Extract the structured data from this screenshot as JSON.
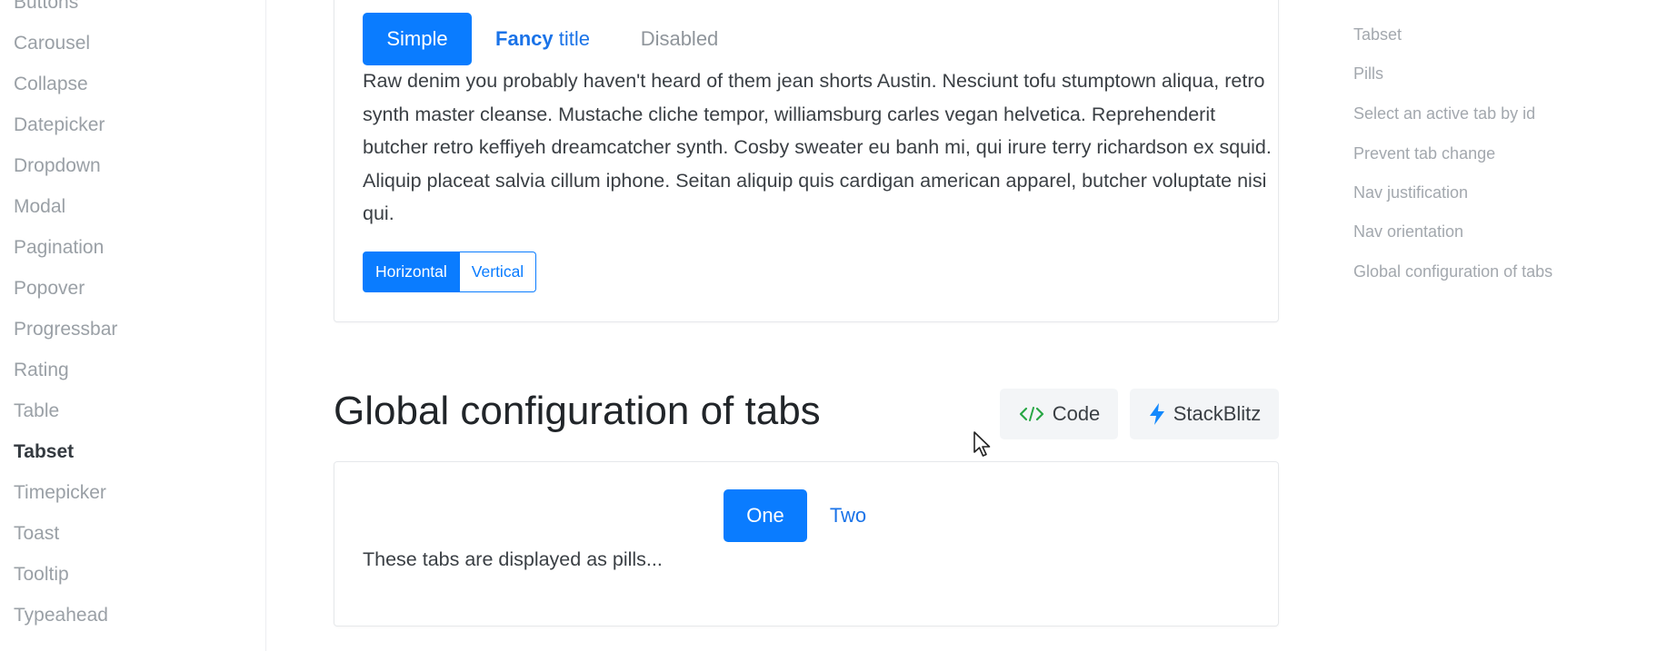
{
  "sidebar": {
    "items": [
      {
        "label": "Buttons",
        "active": false
      },
      {
        "label": "Carousel",
        "active": false
      },
      {
        "label": "Collapse",
        "active": false
      },
      {
        "label": "Datepicker",
        "active": false
      },
      {
        "label": "Dropdown",
        "active": false
      },
      {
        "label": "Modal",
        "active": false
      },
      {
        "label": "Pagination",
        "active": false
      },
      {
        "label": "Popover",
        "active": false
      },
      {
        "label": "Progressbar",
        "active": false
      },
      {
        "label": "Rating",
        "active": false
      },
      {
        "label": "Table",
        "active": false
      },
      {
        "label": "Tabset",
        "active": true
      },
      {
        "label": "Timepicker",
        "active": false
      },
      {
        "label": "Toast",
        "active": false
      },
      {
        "label": "Tooltip",
        "active": false
      },
      {
        "label": "Typeahead",
        "active": false
      }
    ]
  },
  "toc": {
    "items": [
      "Tabset",
      "Pills",
      "Select an active tab by id",
      "Prevent tab change",
      "Nav justification",
      "Nav orientation",
      "Global configuration of tabs"
    ]
  },
  "orientation_demo": {
    "tabs": {
      "simple": "Simple",
      "fancy_bold": "Fancy",
      "fancy_rest": "title",
      "disabled": "Disabled"
    },
    "content": "Raw denim you probably haven't heard of them jean shorts Austin. Nesciunt tofu stumptown aliqua, retro synth master cleanse. Mustache cliche tempor, williamsburg carles vegan helvetica. Reprehenderit butcher retro keffiyeh dreamcatcher synth. Cosby sweater eu banh mi, qui irure terry richardson ex squid. Aliquip placeat salvia cillum iphone. Seitan aliquip quis cardigan american apparel, butcher voluptate nisi qui.",
    "orientation": {
      "horizontal": "Horizontal",
      "vertical": "Vertical",
      "selected": "Horizontal"
    }
  },
  "global_section": {
    "title": "Global configuration of tabs",
    "code_label": "Code",
    "stackblitz_label": "StackBlitz",
    "tabs": {
      "one": "One",
      "two": "Two"
    },
    "content": "These tabs are displayed as pills..."
  },
  "colors": {
    "primary": "#0a7cff",
    "code_icon": "#28a745",
    "stackblitz_icon": "#1389fd"
  }
}
